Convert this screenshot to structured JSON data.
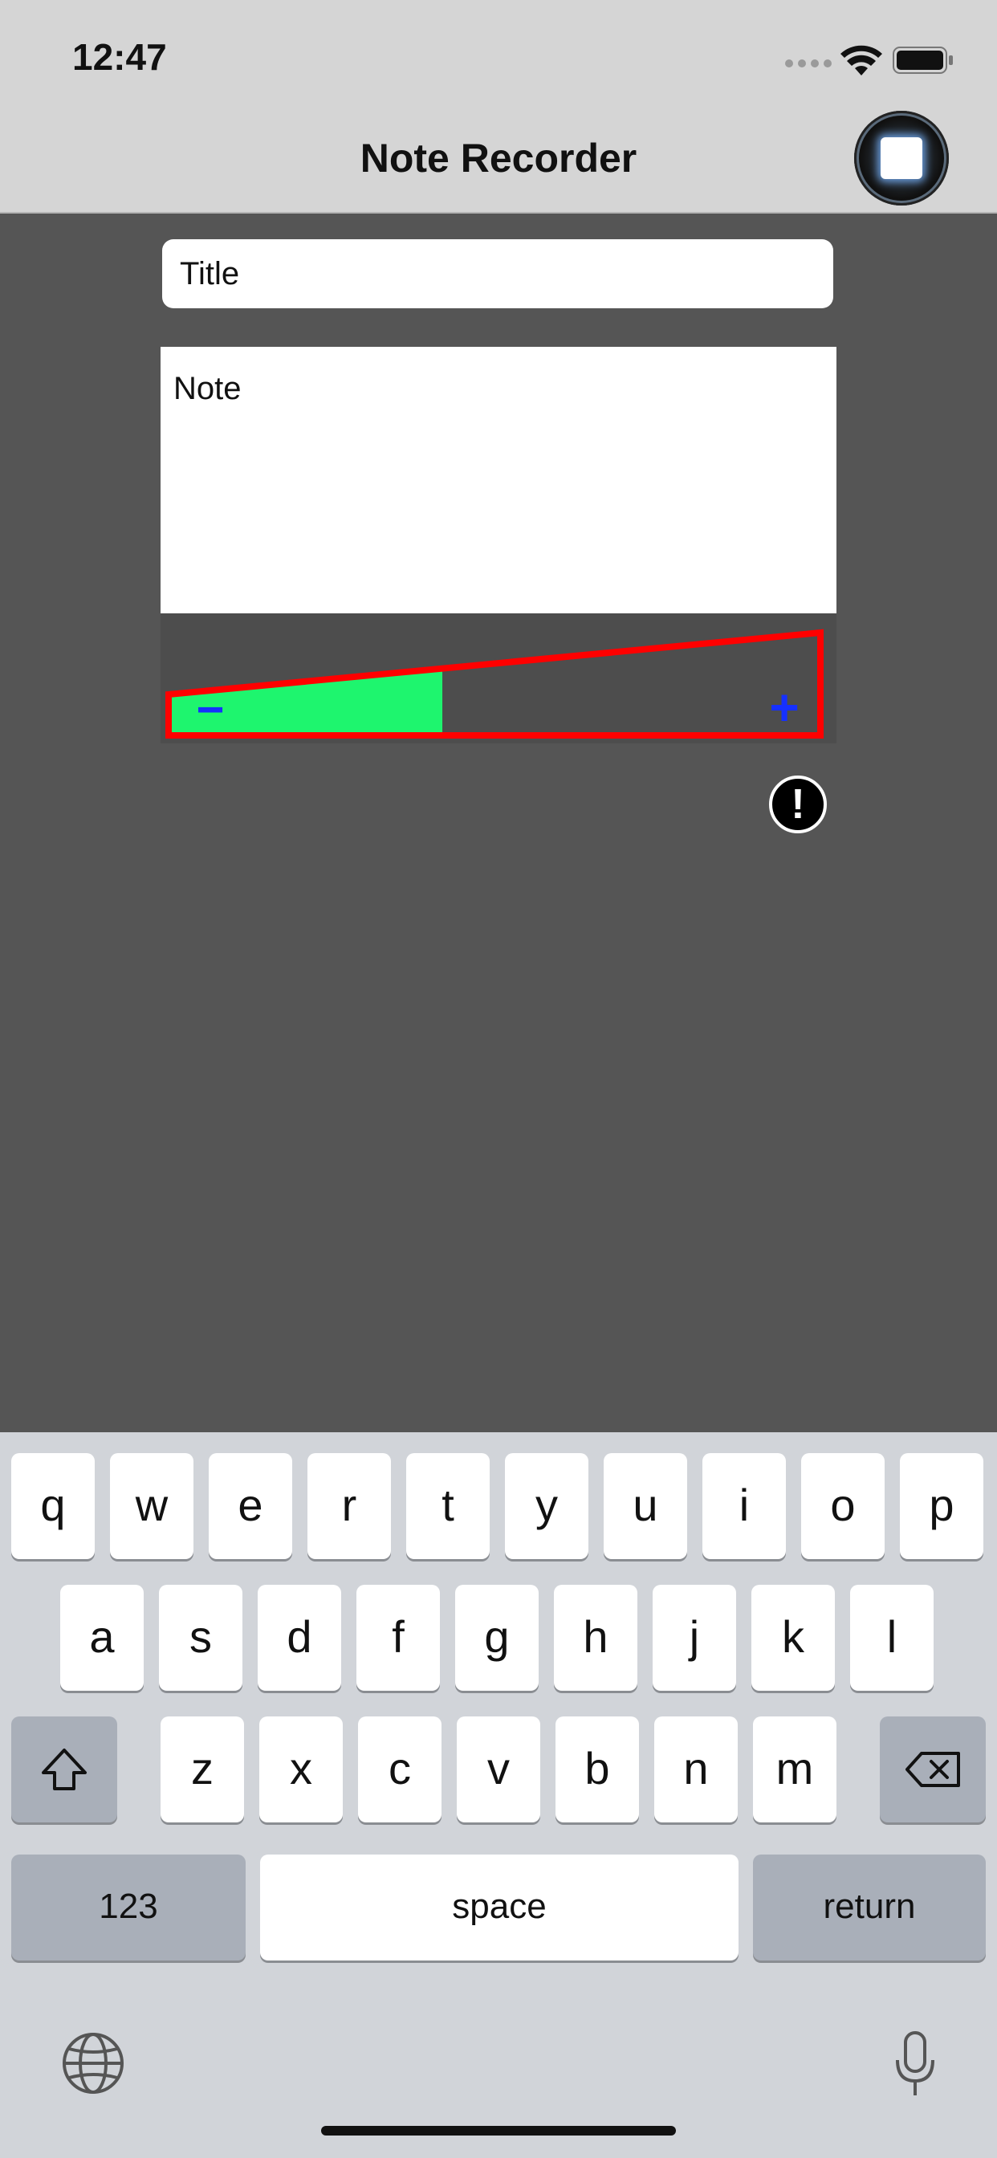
{
  "status_bar": {
    "time": "12:47"
  },
  "nav": {
    "title": "Note Recorder"
  },
  "form": {
    "title_placeholder": "Title",
    "note_placeholder": "Note"
  },
  "volume": {
    "minus_label": "−",
    "plus_label": "+",
    "level_fraction": 0.42
  },
  "alert": {
    "label": "!"
  },
  "keyboard": {
    "row1": [
      "q",
      "w",
      "e",
      "r",
      "t",
      "y",
      "u",
      "i",
      "o",
      "p"
    ],
    "row2": [
      "a",
      "s",
      "d",
      "f",
      "g",
      "h",
      "j",
      "k",
      "l"
    ],
    "row3": [
      "z",
      "x",
      "c",
      "v",
      "b",
      "n",
      "m"
    ],
    "numbers_label": "123",
    "space_label": "space",
    "return_label": "return"
  },
  "colors": {
    "volume_fill": "#1ef56e",
    "volume_outline": "#ff0000",
    "volume_buttons": "#1530ff"
  }
}
